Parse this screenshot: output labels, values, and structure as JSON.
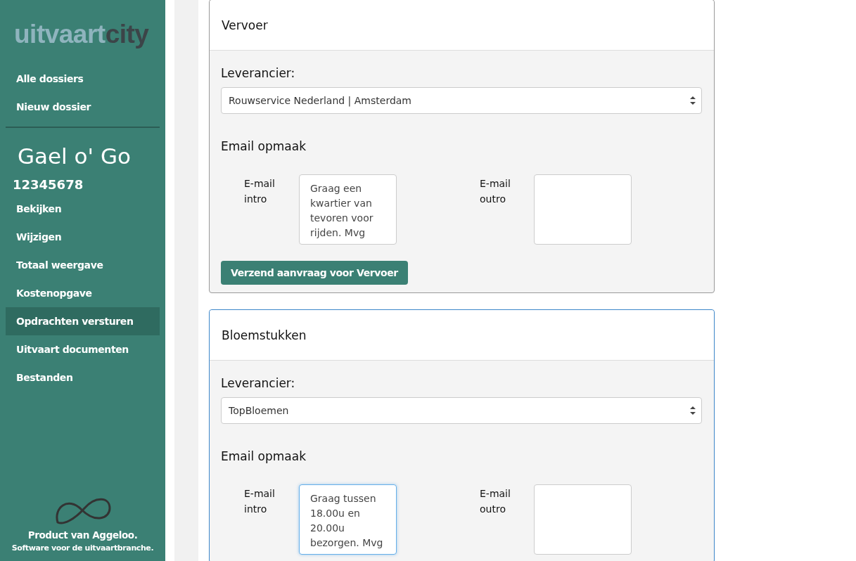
{
  "sidebar": {
    "logo": [
      "uitvaart",
      "city"
    ],
    "top_items": [
      {
        "label": "Alle dossiers",
        "selected": false
      },
      {
        "label": "Nieuw dossier",
        "selected": false
      }
    ],
    "client_name": "Gael o' Go",
    "dossier_number": "12345678",
    "items": [
      {
        "label": "Bekijken",
        "selected": false
      },
      {
        "label": "Wijzigen",
        "selected": false
      },
      {
        "label": "Totaal weergave",
        "selected": false
      },
      {
        "label": "Kostenopgave",
        "selected": false
      },
      {
        "label": "Opdrachten versturen",
        "selected": true
      },
      {
        "label": "Uitvaart documenten",
        "selected": false
      },
      {
        "label": "Bestanden",
        "selected": false
      }
    ],
    "footer": {
      "product": "Product van Aggeloo.",
      "tagline": "Software voor de uitvaartbranche."
    }
  },
  "sections": [
    {
      "title": "Vervoer",
      "focused": false,
      "supplier_label": "Leverancier:",
      "supplier": "Rouwservice Nederland | Amsterdam",
      "email_heading": "Email opmaak",
      "intro_label": "E-mail intro",
      "intro": {
        "value": "Graag een kwartier van tevoren voor rijden. Mvg",
        "focused": false
      },
      "outro_label": "E-mail outro",
      "outro": {
        "focused": false
      },
      "button": "Verzend aanvraag voor Vervoer"
    },
    {
      "title": "Bloemstukken",
      "focused": true,
      "supplier_label": "Leverancier:",
      "supplier": "TopBloemen",
      "email_heading": "Email opmaak",
      "intro_label": "E-mail intro",
      "intro": {
        "value": "Graag tussen 18.00u en 20.00u bezorgen. Mvg",
        "focused": true
      },
      "outro_label": "E-mail outro",
      "outro": {
        "focused": false
      }
    }
  ]
}
